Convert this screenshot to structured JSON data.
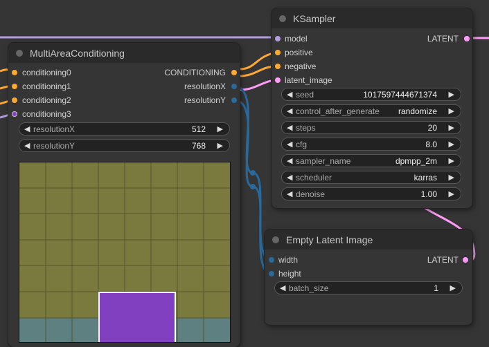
{
  "colors": {
    "background": "#353535",
    "conditioning": "#ffa931",
    "int": "#29699c",
    "latent": "#ff9cf9",
    "model": "#b39ddb",
    "area_fill": "#7a7a3e",
    "area_secondary": "#5f8080",
    "area_selected": "#8040c0"
  },
  "multi": {
    "title": "MultiAreaConditioning",
    "inputs": [
      "conditioning0",
      "conditioning1",
      "conditioning2",
      "conditioning3"
    ],
    "outputs": [
      "CONDITIONING",
      "resolutionX",
      "resolutionY"
    ],
    "widgets": [
      {
        "label": "resolutionX",
        "value": "512"
      },
      {
        "label": "resolutionY",
        "value": "768"
      }
    ]
  },
  "ksampler": {
    "title": "KSampler",
    "inputs": [
      "model",
      "positive",
      "negative",
      "latent_image"
    ],
    "output": "LATENT",
    "widgets": [
      {
        "label": "seed",
        "value": "1017597444671374"
      },
      {
        "label": "control_after_generate",
        "value": "randomize"
      },
      {
        "label": "steps",
        "value": "20"
      },
      {
        "label": "cfg",
        "value": "8.0"
      },
      {
        "label": "sampler_name",
        "value": "dpmpp_2m"
      },
      {
        "label": "scheduler",
        "value": "karras"
      },
      {
        "label": "denoise",
        "value": "1.00"
      }
    ]
  },
  "latent": {
    "title": "Empty Latent Image",
    "inputs": [
      "width",
      "height"
    ],
    "output": "LATENT",
    "widgets": [
      {
        "label": "batch_size",
        "value": "1"
      }
    ]
  }
}
